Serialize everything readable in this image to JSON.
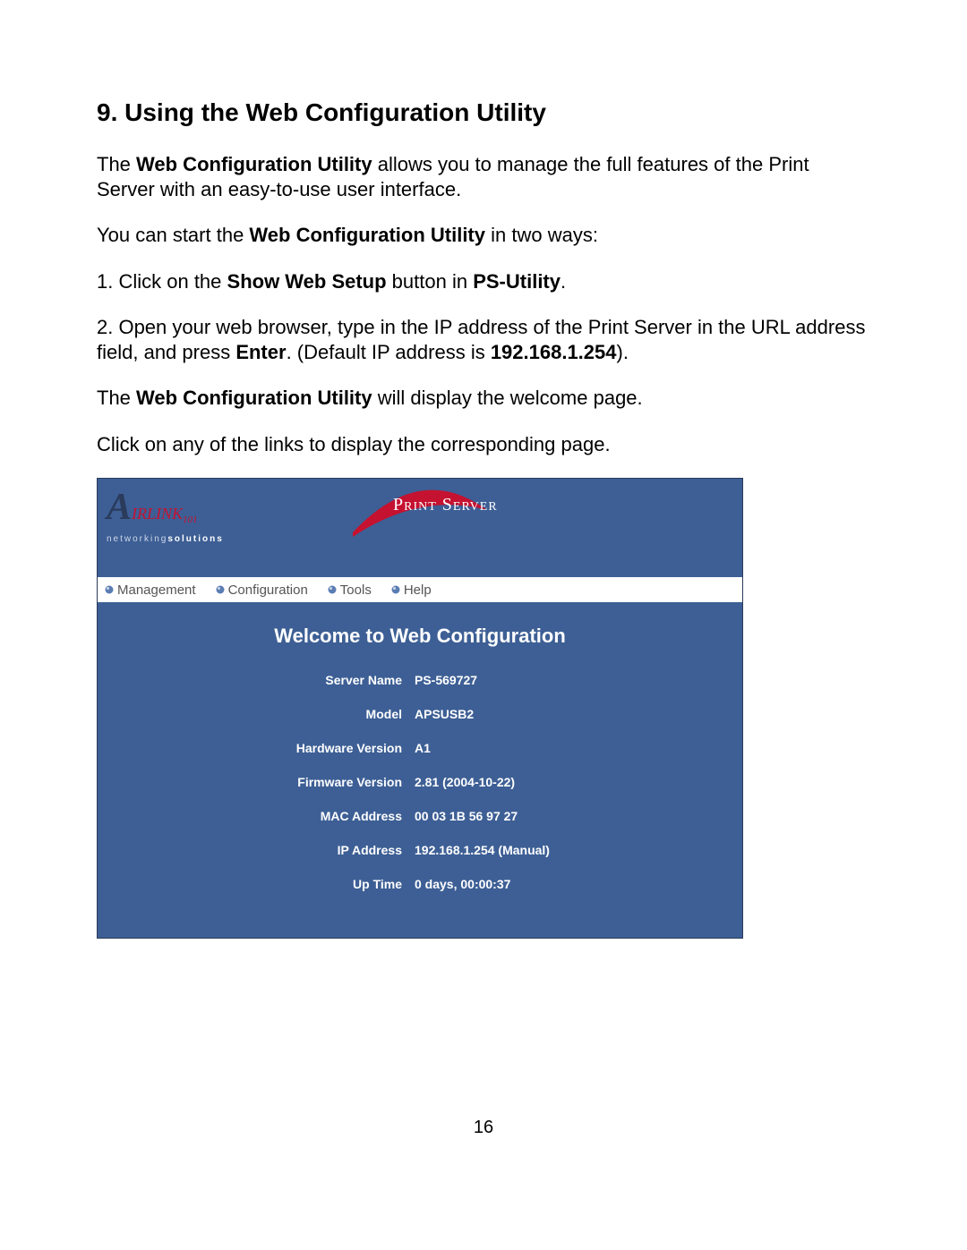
{
  "section": {
    "title": "9. Using the Web Configuration Utility"
  },
  "paragraphs": {
    "p1a": "The ",
    "p1b": "Web Configuration Utility",
    "p1c": " allows you to manage the full features of the Print Server with an easy-to-use user interface.",
    "p2a": "You can start the ",
    "p2b": "Web Configuration Utility",
    "p2c": " in two ways:",
    "p3a": "1. Click on the ",
    "p3b": "Show Web Setup",
    "p3c": " button in ",
    "p3d": "PS-Utility",
    "p3e": ".",
    "p4a": "2. Open your web browser, type in the IP address of the Print Server in the URL address field, and press ",
    "p4b": "Enter",
    "p4c": ". (Default IP address is ",
    "p4d": "192.168.1.254",
    "p4e": ").",
    "p5a": "The ",
    "p5b": "Web Configuration Utility",
    "p5c": " will display the welcome page.",
    "p6": "Click on any of the links to display the corresponding page."
  },
  "logo": {
    "brand_prefix": "A",
    "brand_rest": "IRLINK",
    "brand_suffix": "101",
    "tagline_a": "networking",
    "tagline_b": "solutions",
    "product": "Print Server"
  },
  "menu": {
    "items": [
      "Management",
      "Configuration",
      "Tools",
      "Help"
    ]
  },
  "welcome": {
    "title": "Welcome to Web Configuration",
    "rows": [
      {
        "label": "Server Name",
        "value": "PS-569727"
      },
      {
        "label": "Model",
        "value": "APSUSB2"
      },
      {
        "label": "Hardware Version",
        "value": "A1"
      },
      {
        "label": "Firmware Version",
        "value": "2.81 (2004-10-22)"
      },
      {
        "label": "MAC Address",
        "value": "00 03 1B 56 97 27"
      },
      {
        "label": "IP Address",
        "value": "192.168.1.254 (Manual)"
      },
      {
        "label": "Up Time",
        "value": "0 days, 00:00:37"
      }
    ]
  },
  "page_number": "16"
}
